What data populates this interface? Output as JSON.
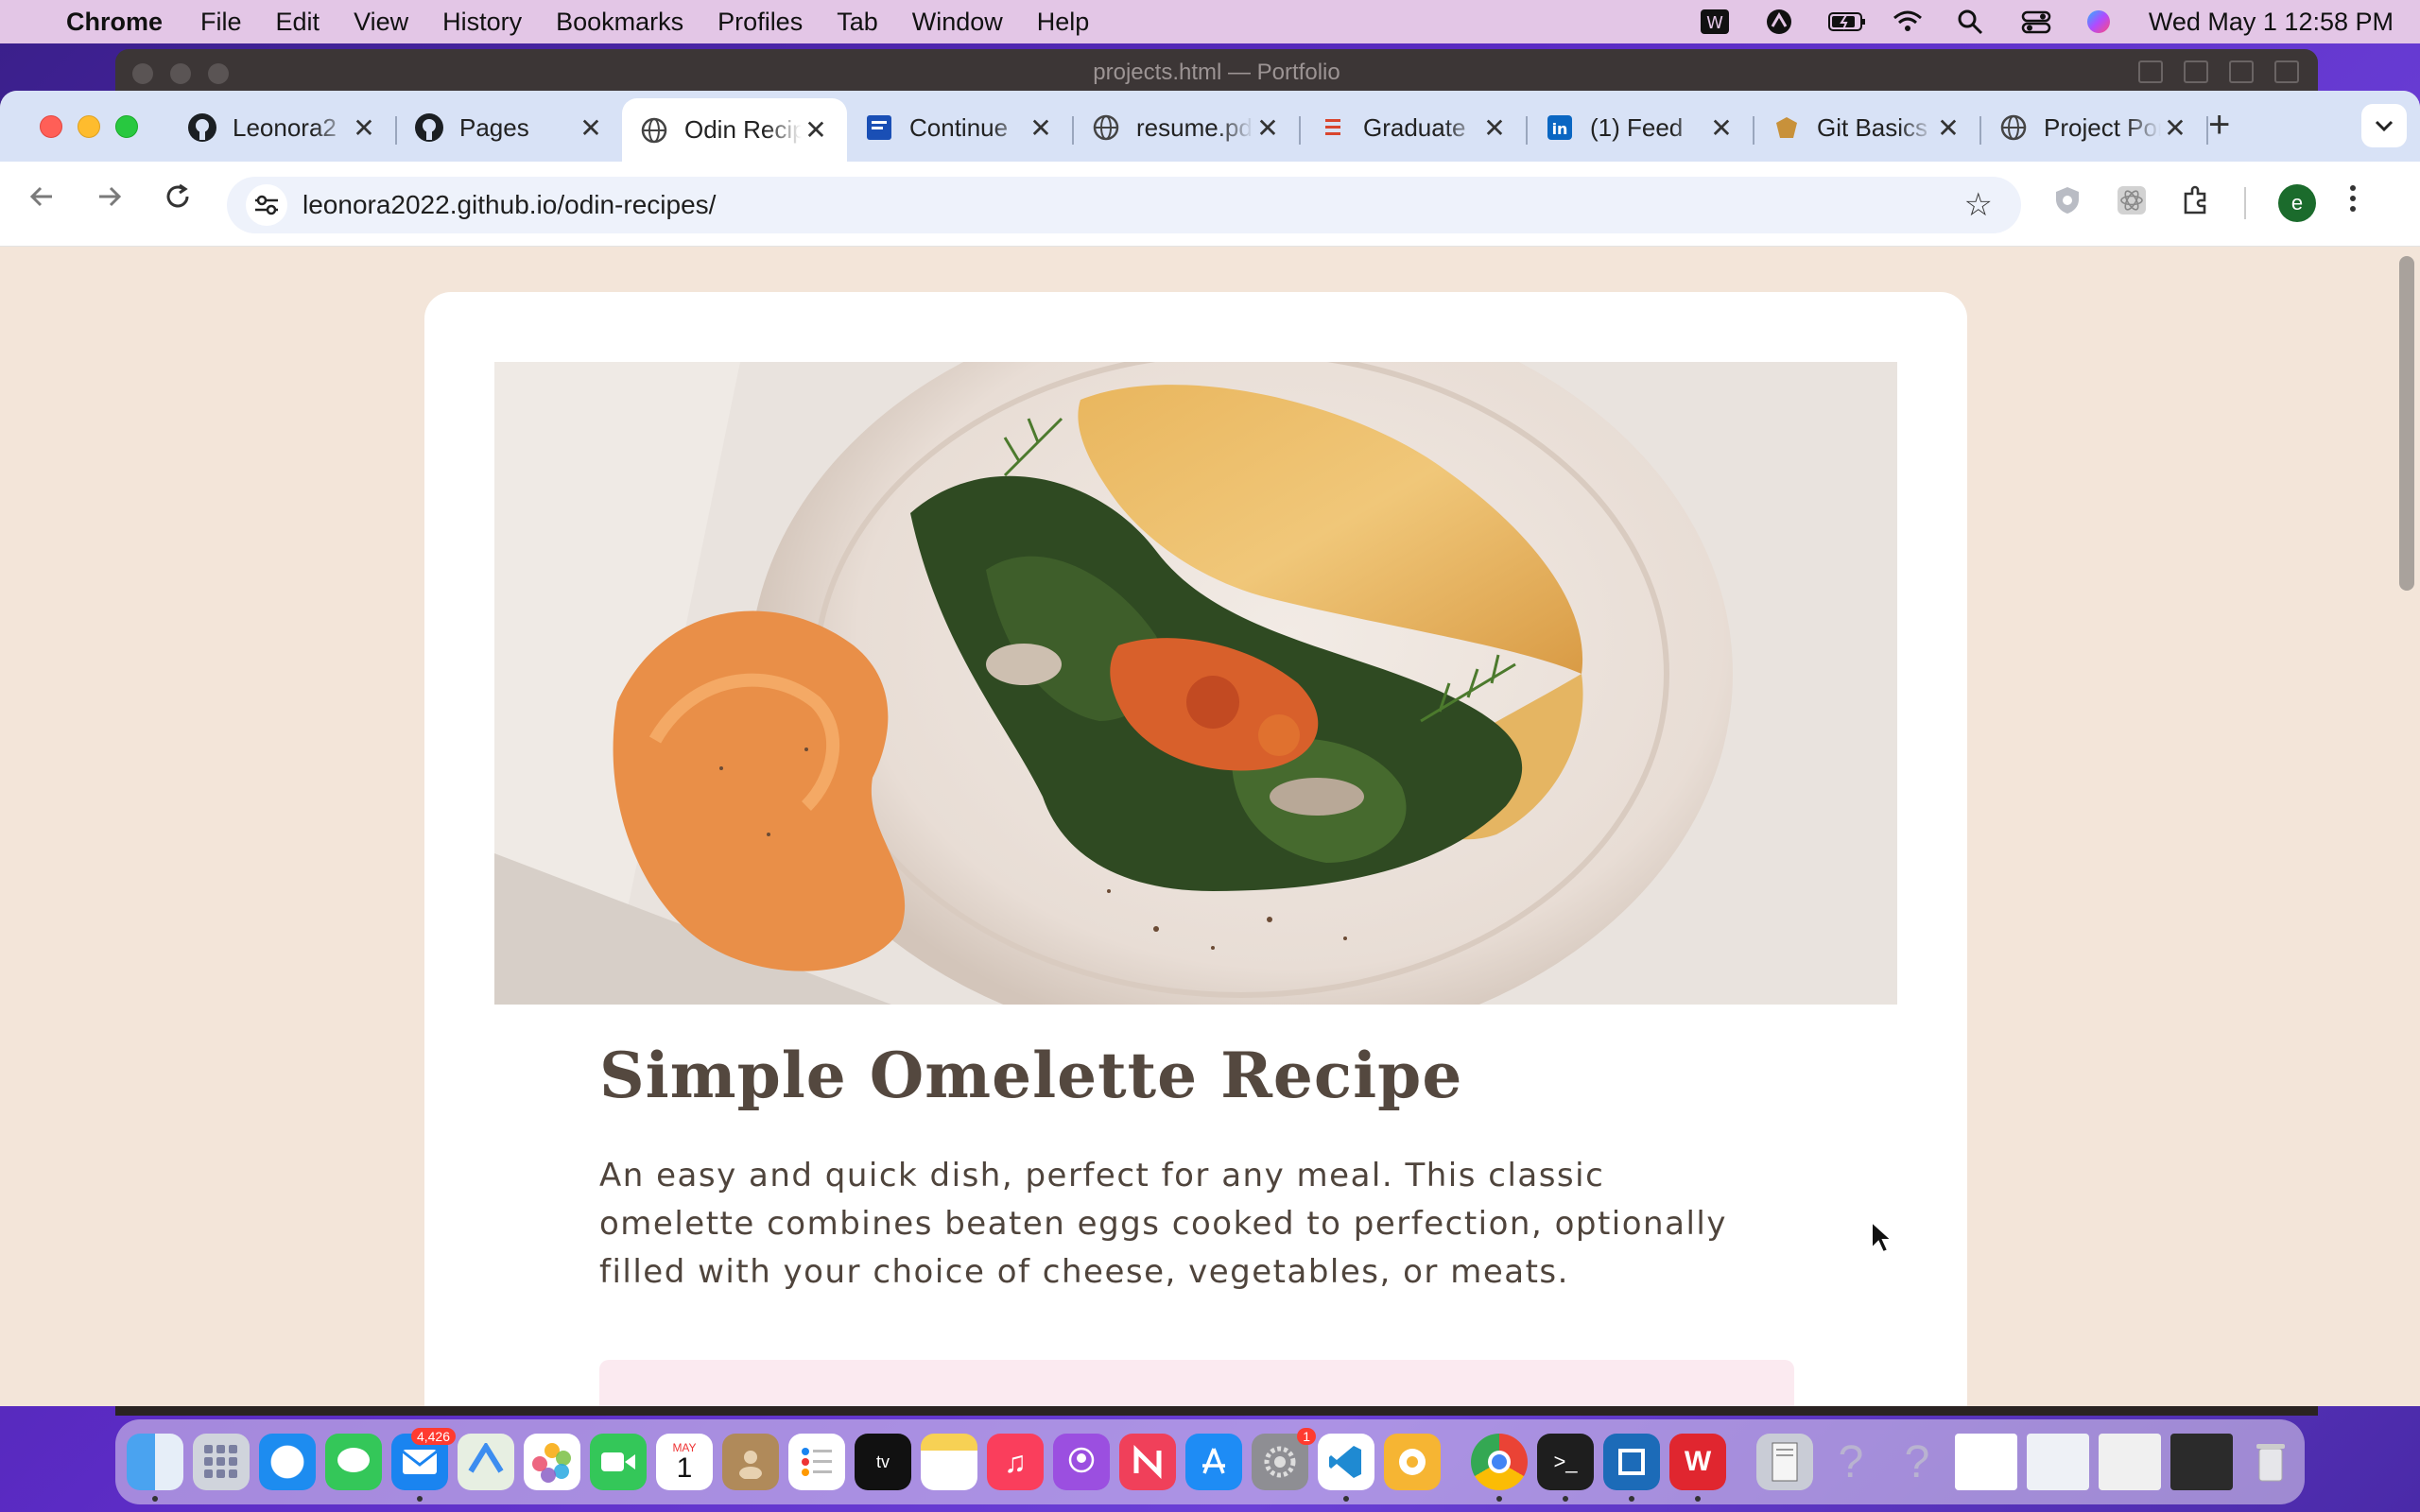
{
  "menubar": {
    "app_name": "Chrome",
    "menus": [
      "File",
      "Edit",
      "View",
      "History",
      "Bookmarks",
      "Profiles",
      "Tab",
      "Window",
      "Help"
    ],
    "datetime": "Wed May 1  12:58 PM"
  },
  "background_window": {
    "title": "projects.html — Portfolio"
  },
  "tabs": [
    {
      "title": "Leonora2",
      "icon": "github-icon",
      "active": false
    },
    {
      "title": "Pages",
      "icon": "github-icon",
      "active": false
    },
    {
      "title": "Odin Recipes",
      "icon": "globe-icon",
      "active": true
    },
    {
      "title": "Continue",
      "icon": "document-icon",
      "active": false
    },
    {
      "title": "resume.pdf",
      "icon": "globe-icon",
      "active": false
    },
    {
      "title": "Graduate",
      "icon": "list-icon",
      "active": false
    },
    {
      "title": "(1) Feed",
      "icon": "linkedin-icon",
      "active": false
    },
    {
      "title": "Git Basics",
      "icon": "odin-icon",
      "active": false
    },
    {
      "title": "Project Portfolio",
      "icon": "globe-icon",
      "active": false
    }
  ],
  "toolbar": {
    "url_host": "leonora2022.github.io",
    "url_path": "/odin-recipes/",
    "avatar_letter": "e"
  },
  "page": {
    "title": "Simple Omelette Recipe",
    "description": "An easy and quick dish, perfect for any meal. This classic omelette combines beaten eggs cooked to perfection, optionally filled with your choice of cheese, vegetables, or meats."
  },
  "dock": {
    "mail_badge": "4,426",
    "calendar_month": "MAY",
    "calendar_day": "1",
    "settings_badge": "1"
  }
}
